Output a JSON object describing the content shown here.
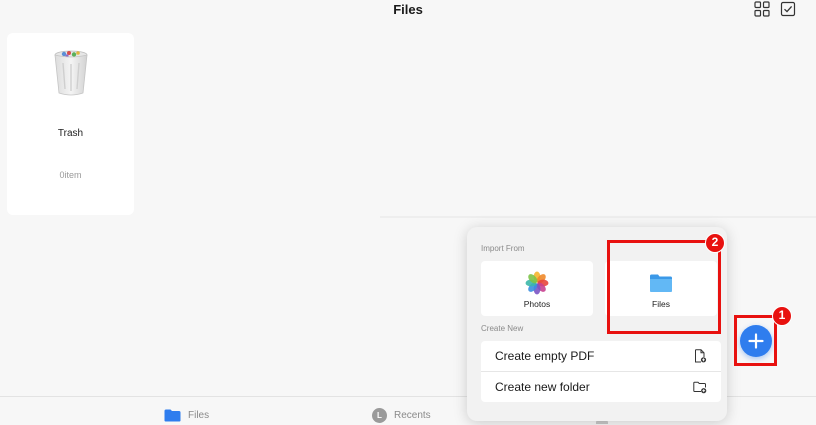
{
  "header": {
    "title": "Files",
    "grid_icon": "grid-view-icon",
    "select_icon": "select-checkbox-icon"
  },
  "content": {
    "items": [
      {
        "name": "Trash",
        "count": "0item",
        "icon": "trash-bin-icon"
      }
    ]
  },
  "popover": {
    "import_label": "Import From",
    "import_options": [
      {
        "label": "Photos",
        "icon": "photos-icon"
      },
      {
        "label": "Files",
        "icon": "folder-icon"
      }
    ],
    "create_label": "Create New",
    "create_options": [
      {
        "label": "Create empty PDF",
        "icon": "new-pdf-icon"
      },
      {
        "label": "Create new folder",
        "icon": "new-folder-icon"
      }
    ]
  },
  "fab": {
    "icon": "plus-icon"
  },
  "annotations": {
    "badge_1": "1",
    "badge_2": "2",
    "color": "#e8110f"
  },
  "tabbar": {
    "tabs": [
      {
        "label": "Files",
        "icon": "folder-icon"
      },
      {
        "label": "Recents",
        "icon": "recents-icon",
        "glyph": "L"
      }
    ]
  },
  "colors": {
    "accent": "#2f7dee",
    "folder": "#4aa8f0",
    "background": "#f7f7f7"
  }
}
